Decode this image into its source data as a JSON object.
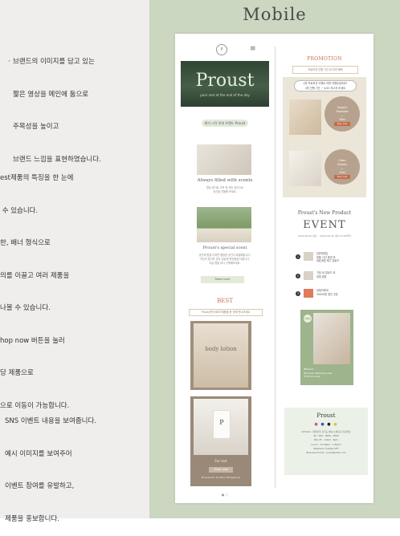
{
  "page": {
    "title": "Mobile"
  },
  "notes": {
    "n1": [
      "브랜드의 이미지를 담고 있는",
      "짧은 영상을 메인에 둠으로",
      "주목성을 높이고",
      "브랜드 느낌을 표현하였습니다."
    ],
    "n2": [
      "est제품의 특징을 한 눈에",
      " 수 있습니다.",
      "한, 배너 형식으로",
      "의를 이끌고 여러 제품을",
      "나볼 수 있습니다.",
      "hop now 버튼을 눌러",
      "당 제품으로",
      "으로 이동이 가능합니다."
    ],
    "n3": [
      "SNS 이벤트 내용을 보여줍니다.",
      "예시 이미지를 보여주어",
      "이벤트 참여를 유발하고,",
      "제품을 홍보합니다."
    ]
  },
  "mobile_left": {
    "hero_word": "Proust",
    "hero_sub": "pure rest at the end of the day",
    "tag": "향기 시각 하지 브랜드 Proust",
    "caption1": "Always filled with scents",
    "caption2": "Proust's special scent",
    "small1": [
      "향당 방기로 가득 한 모든 공간으로",
      "공간을 선물해 보세요."
    ],
    "small2": [
      "공간에 향을 더하면 평범한 공간이 특별해집니다.",
      "자연의 향기를 담아 일상에 편안함을 더합니다.",
      "오늘 향을 하나 선택해보세요."
    ],
    "read_more": "Read more",
    "best_title": "BEST",
    "best_sub": "Proust만의 BEST제품을 한 눈에 만나보세요",
    "product1_label": "body lotion",
    "product2_name": "For rest",
    "product2_btn": "Shop now",
    "product2_tags": "#Lavender   #Cotton   #Fragrance",
    "dots": "● ○"
  },
  "mobile_right": {
    "promo_title": "PROMOTION",
    "promo_sub": "프로모션 진행 기간 내 자격 혜택",
    "promo_q": [
      "4월 프로모션 이벤트 어떤 이벤트일까요?",
      "4월 진행 기간 ~ 4/20 지나지 마세요"
    ],
    "promo1": [
      "Organic",
      "Shampoo",
      "—",
      "30ml"
    ],
    "promo1_btn": "Buy now",
    "promo2": [
      "Clean",
      "Shower",
      "—",
      "12ml"
    ],
    "promo2_btn": "Buy now",
    "event_pre": "Proust's New Product",
    "event_title": "EVENT",
    "event_date": "2024.00.00 (월) ~ 2024.00.00 (일) 23:59까지",
    "event_rows": [
      {
        "num": "1",
        "text": "[참여방법]\n제품 사진 촬영 후\n대표계정 태그 업로드"
      },
      {
        "num": "2",
        "text": "기한 내 업로드 후\n당첨 발표"
      },
      {
        "num": "3",
        "text": "당첨자에게\n30000원 할인 쿠폰"
      }
    ],
    "ev_badge": "이벤트",
    "ev_cap": "#Proust\n#proust cleansing soap\n# Proust soap",
    "footer_brand": "Proust",
    "footer_icons": "● ● ● ●",
    "footer_lines": "Address : 대한민국 경기도 성남시 분당구 판교역로\nTel : 000 - 0000 - 0000\nMon-Fri : 10am - 6pm\nLunch : 12:30pm - 1:30pm\nWeekend, Holiday OFF\nBusiness E-mail : proust@mail.com"
  }
}
